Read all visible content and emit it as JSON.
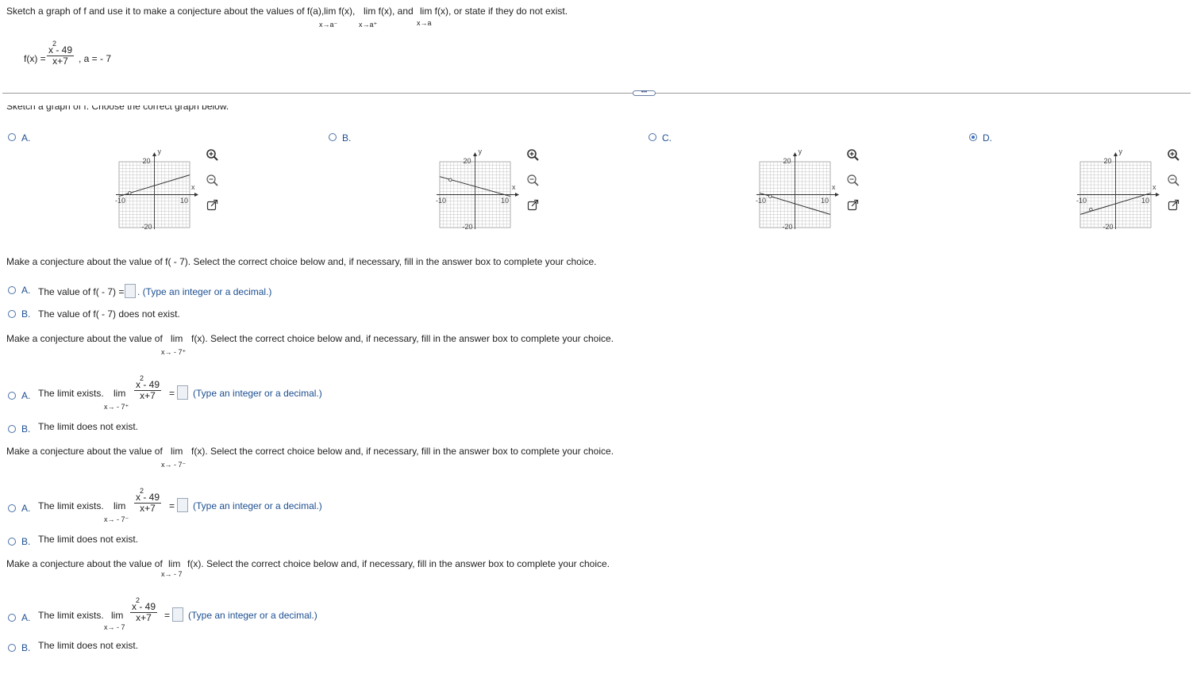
{
  "instruction": {
    "text": "Sketch a graph of f and use it to make a conjecture about the values of f(a),",
    "lim1": "lim f(x),",
    "lim1_sub": "x→a⁻",
    "lim2": "lim f(x), and",
    "lim2_sub": "x→a⁺",
    "lim3": "lim f(x), or state if they do not exist.",
    "lim3_sub": "x→a"
  },
  "function": {
    "lhs": "f(x) =",
    "numerator": "x - 49",
    "exponent": "2",
    "denominator": "x+7",
    "a_value": ", a = - 7"
  },
  "cut_heading": "Sketch a graph of f. Choose the correct graph below.",
  "graph_choices": [
    {
      "letter": "A.",
      "selected": false
    },
    {
      "letter": "B.",
      "selected": false
    },
    {
      "letter": "C.",
      "selected": false
    },
    {
      "letter": "D.",
      "selected": true
    }
  ],
  "graph_labels": {
    "y": "y",
    "x": "x",
    "y_top": "20",
    "y_bottom": "-20",
    "x_left": "-10",
    "x_right": "10"
  },
  "q1": {
    "prompt": "Make a conjecture about the value of f( - 7). Select the correct choice below and, if necessary, fill in the answer box to complete your choice.",
    "a_letter": "A.",
    "a_text": "The value of f( - 7) =",
    "a_hint": ". (Type an integer or a decimal.)",
    "b_letter": "B.",
    "b_text": "The value of f( - 7) does not exist."
  },
  "q2": {
    "prompt_pre": "Make a conjecture about the value of",
    "prompt_lim": "lim",
    "prompt_sub": "x→ - 7⁺",
    "prompt_post": "f(x). Select the correct choice below and, if necessary, fill in the answer box to complete your choice.",
    "a_letter": "A.",
    "a_text": "The limit exists.",
    "a_lim": "lim",
    "a_sub": "x→ - 7⁺",
    "a_num": "x - 49",
    "a_exp": "2",
    "a_den": "x+7",
    "a_eq": "=",
    "a_hint": "(Type an integer or a decimal.)",
    "b_letter": "B.",
    "b_text": "The limit does not exist."
  },
  "q3": {
    "prompt_pre": "Make a conjecture about the value of",
    "prompt_lim": "lim",
    "prompt_sub": "x→ - 7⁻",
    "prompt_post": "f(x). Select the correct choice below and, if necessary, fill in the answer box to complete your choice.",
    "a_letter": "A.",
    "a_text": "The limit exists.",
    "a_lim": "lim",
    "a_sub": "x→ - 7⁻",
    "a_num": "x - 49",
    "a_exp": "2",
    "a_den": "x+7",
    "a_eq": "=",
    "a_hint": "(Type an integer or a decimal.)",
    "b_letter": "B.",
    "b_text": "The limit does not exist."
  },
  "q4": {
    "prompt_pre": "Make a conjecture about the value of",
    "prompt_lim": "lim",
    "prompt_sub": "x→ - 7",
    "prompt_post": "f(x). Select the correct choice below and, if necessary, fill in the answer box to complete your choice.",
    "a_letter": "A.",
    "a_text": "The limit exists.",
    "a_lim": "lim",
    "a_sub": "x→ - 7",
    "a_num": "x - 49",
    "a_exp": "2",
    "a_den": "x+7",
    "a_eq": "=",
    "a_hint": "(Type an integer or a decimal.)",
    "b_letter": "B.",
    "b_text": "The limit does not exist."
  },
  "divider_handle": "•••",
  "colors": {
    "accent": "#1d4f91",
    "radio": "#4a6fa5",
    "selected": "#3a6ec2",
    "grid": "#b9b9b9"
  }
}
